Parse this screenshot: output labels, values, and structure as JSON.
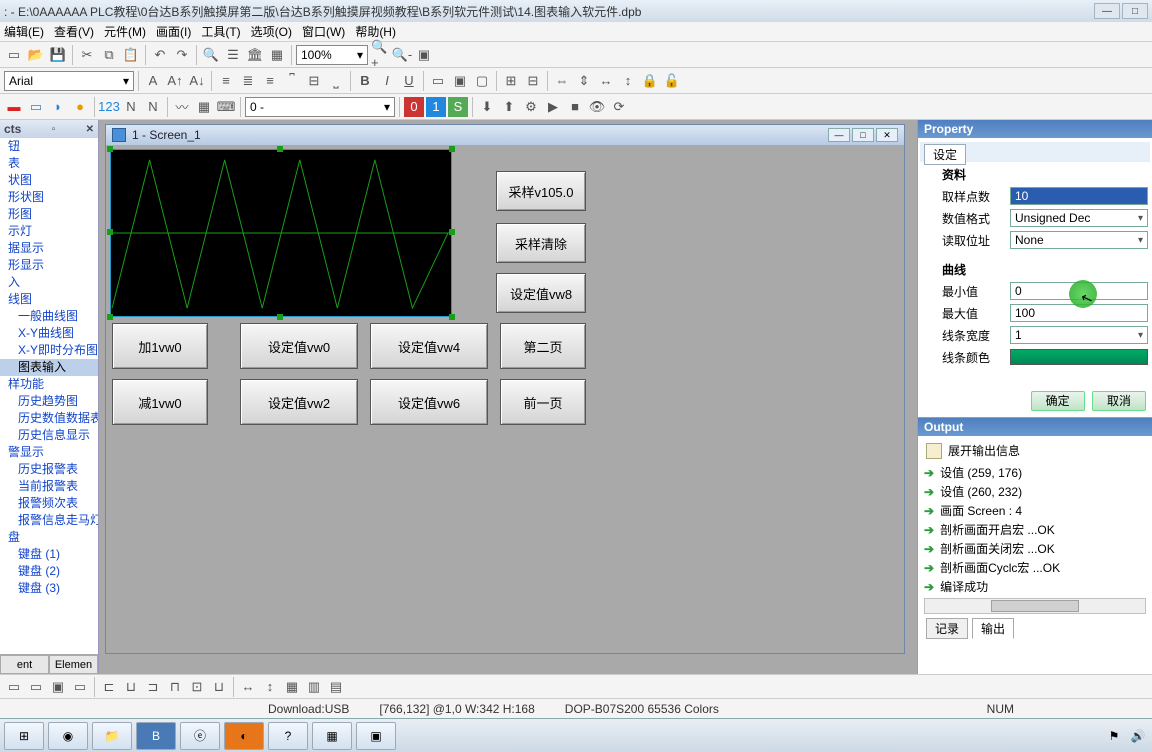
{
  "title": ": - E:\\0AAAAAA PLC教程\\0台达B系列触摸屏第二版\\台达B系列触摸屏视频教程\\B系列软元件测试\\14.图表输入软元件.dpb",
  "menu": [
    "编辑(E)",
    "查看(V)",
    "元件(M)",
    "画面(I)",
    "工具(T)",
    "选项(O)",
    "窗口(W)",
    "帮助(H)"
  ],
  "zoom": "100%",
  "font": "Arial",
  "palette_sel": "0 -",
  "left": {
    "header": "cts",
    "items": [
      {
        "t": "钮"
      },
      {
        "t": "表"
      },
      {
        "t": "状图"
      },
      {
        "t": "形状图"
      },
      {
        "t": "形图"
      },
      {
        "t": "示灯"
      },
      {
        "t": "据显示"
      },
      {
        "t": "形显示"
      },
      {
        "t": "入"
      },
      {
        "t": "线图"
      },
      {
        "t": "一般曲线图",
        "ind": true
      },
      {
        "t": "X-Y曲线图",
        "ind": true
      },
      {
        "t": "X-Y即时分布图",
        "ind": true
      },
      {
        "t": "图表输入",
        "ind": true,
        "sel": true
      },
      {
        "t": "样功能"
      },
      {
        "t": "历史趋势图",
        "ind": true
      },
      {
        "t": "历史数值数据表",
        "ind": true
      },
      {
        "t": "历史信息显示",
        "ind": true
      },
      {
        "t": "警显示"
      },
      {
        "t": "历史报警表",
        "ind": true
      },
      {
        "t": "当前报警表",
        "ind": true
      },
      {
        "t": "报警频次表",
        "ind": true
      },
      {
        "t": "报警信息走马灯",
        "ind": true
      },
      {
        "t": "盘"
      },
      {
        "t": "键盘 (1)",
        "ind": true
      },
      {
        "t": "键盘 (2)",
        "ind": true
      },
      {
        "t": "键盘 (3)",
        "ind": true
      }
    ],
    "tabs": [
      "ent",
      "Elemen"
    ]
  },
  "screen": {
    "title": "1 - Screen_1",
    "buttons": {
      "b1": "采样v105.0",
      "b2": "采样清除",
      "b3": "设定值vw8",
      "g1": "加1vw0",
      "g2": "设定值vw0",
      "g3": "设定值vw4",
      "g4": "第二页",
      "g5": "减1vw0",
      "g6": "设定值vw2",
      "g7": "设定值vw6",
      "g8": "前一页"
    }
  },
  "prop": {
    "header": "Property",
    "tab": "设定",
    "sect1": "资料",
    "rows1": [
      {
        "l": "取样点数",
        "v": "10",
        "sel": true
      },
      {
        "l": "数值格式",
        "v": "Unsigned Dec",
        "drop": true
      },
      {
        "l": "读取位址",
        "v": "None",
        "drop": true
      }
    ],
    "sect2": "曲线",
    "rows2": [
      {
        "l": "最小值",
        "v": "0"
      },
      {
        "l": "最大值",
        "v": "100"
      },
      {
        "l": "线条宽度",
        "v": "1",
        "drop": true
      },
      {
        "l": "线条颜色",
        "color": true
      }
    ],
    "ok": "确定",
    "cancel": "取消"
  },
  "output": {
    "header": "Output",
    "info": "展开输出信息",
    "lines": [
      "设值 (259, 176)",
      "设值 (260, 232)",
      "画面 Screen : 4",
      "剖析画面开启宏 ...OK",
      "剖析画面关闭宏 ...OK",
      "剖析画面Cyclc宏 ...OK",
      "编译成功"
    ],
    "tabs": [
      "记录",
      "输出"
    ]
  },
  "status": {
    "dl": "Download:USB",
    "coord": "[766,132] @1,0 W:342 H:168",
    "device": "DOP-B07S200 65536 Colors",
    "num": "NUM"
  },
  "chart_data": {
    "type": "line",
    "title": "",
    "x": [
      0,
      1,
      2,
      3,
      4,
      5,
      6,
      7,
      8,
      9
    ],
    "values": [
      0,
      100,
      0,
      100,
      0,
      100,
      0,
      100,
      0,
      50
    ],
    "ylim": [
      0,
      100
    ],
    "color": "#17a017"
  }
}
